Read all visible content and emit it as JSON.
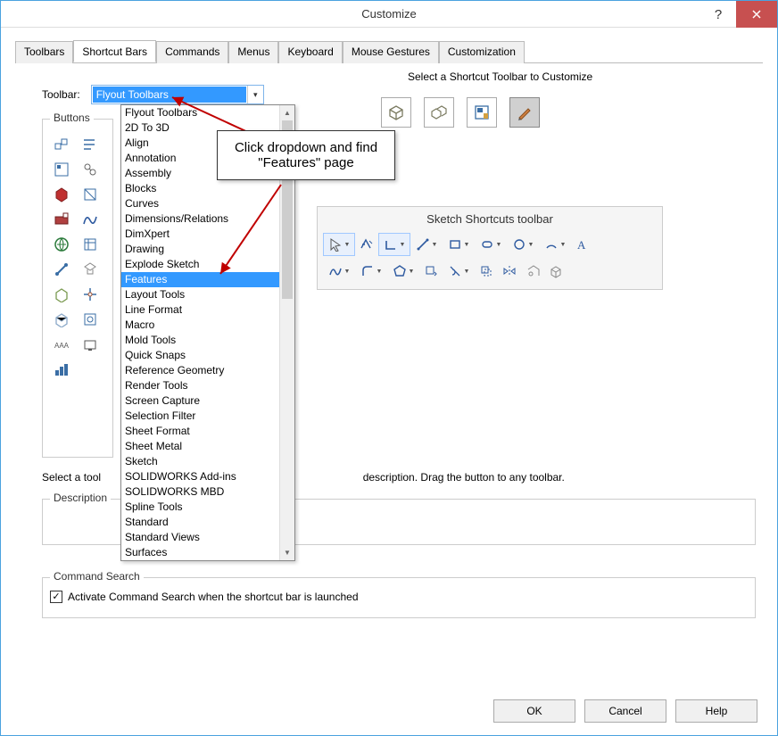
{
  "window": {
    "title": "Customize"
  },
  "tabs": [
    "Toolbars",
    "Shortcut Bars",
    "Commands",
    "Menus",
    "Keyboard",
    "Mouse Gestures",
    "Customization"
  ],
  "active_tab": "Shortcut Bars",
  "toolbar_label": "Toolbar:",
  "toolbar_value": "Flyout Toolbars",
  "dropdown_items": [
    "Flyout Toolbars",
    "2D To 3D",
    "Align",
    "Annotation",
    "Assembly",
    "Blocks",
    "Curves",
    "Dimensions/Relations",
    "DimXpert",
    "Drawing",
    "Explode Sketch",
    "Features",
    "Layout Tools",
    "Line Format",
    "Macro",
    "Mold Tools",
    "Quick Snaps",
    "Reference Geometry",
    "Render Tools",
    "Screen Capture",
    "Selection Filter",
    "Sheet Format",
    "Sheet Metal",
    "Sketch",
    "SOLIDWORKS Add-ins",
    "SOLIDWORKS MBD",
    "Spline Tools",
    "Standard",
    "Standard Views",
    "Surfaces"
  ],
  "dropdown_highlight": "Features",
  "buttons_group_label": "Buttons",
  "select_toolbar_label": "Select a Shortcut Toolbar to Customize",
  "sketch_title": "Sketch Shortcuts toolbar",
  "help_text": "Select a tool",
  "help_suffix": "description. Drag the button to any toolbar.",
  "desc_label": "Description",
  "cmd_label": "Command Search",
  "cmd_checkbox_label": "Activate Command Search when the shortcut bar is launched",
  "callout_text": "Click dropdown and find \"Features\" page",
  "buttons": {
    "ok": "OK",
    "cancel": "Cancel",
    "help": "Help"
  },
  "context_icons": [
    "part-icon",
    "assembly-icon",
    "drawing-icon",
    "sketch-icon"
  ]
}
